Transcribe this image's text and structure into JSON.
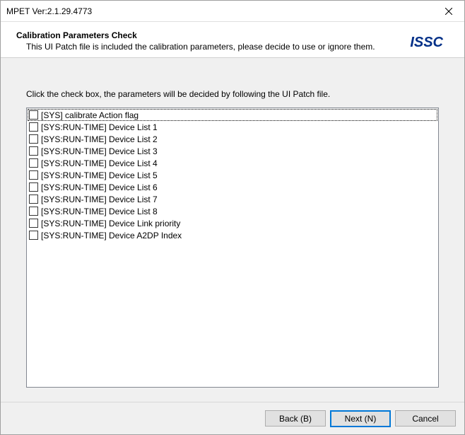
{
  "titlebar": {
    "text": "MPET Ver:2.1.29.4773"
  },
  "header": {
    "title": "Calibration Parameters Check",
    "subtitle": "This UI Patch file is included the calibration parameters, please decide to use or ignore them.",
    "logo_text": "ISSC"
  },
  "content": {
    "instruction": "Click the check box, the parameters will be decided by following the UI Patch file.",
    "items": [
      {
        "label": "[SYS] calibrate Action flag"
      },
      {
        "label": "[SYS:RUN-TIME] Device List 1"
      },
      {
        "label": "[SYS:RUN-TIME] Device List 2"
      },
      {
        "label": "[SYS:RUN-TIME] Device List 3"
      },
      {
        "label": "[SYS:RUN-TIME] Device List 4"
      },
      {
        "label": "[SYS:RUN-TIME] Device List 5"
      },
      {
        "label": "[SYS:RUN-TIME] Device List 6"
      },
      {
        "label": "[SYS:RUN-TIME] Device List 7"
      },
      {
        "label": "[SYS:RUN-TIME] Device List 8"
      },
      {
        "label": "[SYS:RUN-TIME] Device Link priority"
      },
      {
        "label": "[SYS:RUN-TIME] Device A2DP Index"
      }
    ]
  },
  "footer": {
    "back_label": "Back (B)",
    "next_label": "Next (N)",
    "cancel_label": "Cancel"
  }
}
